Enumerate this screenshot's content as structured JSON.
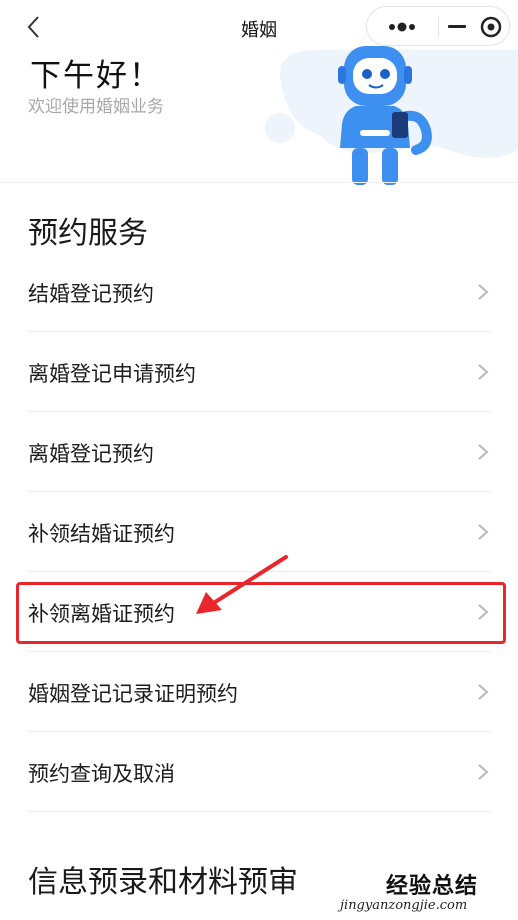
{
  "navbar": {
    "title": "婚姻"
  },
  "header": {
    "greeting": "下午好！",
    "welcome": "欢迎使用婚姻业务"
  },
  "booking": {
    "title": "预约服务",
    "items": [
      {
        "label": "结婚登记预约"
      },
      {
        "label": "离婚登记申请预约"
      },
      {
        "label": "离婚登记预约"
      },
      {
        "label": "补领结婚证预约"
      },
      {
        "label": "补领离婚证预约"
      },
      {
        "label": "婚姻登记记录证明预约"
      },
      {
        "label": "预约查询及取消"
      }
    ]
  },
  "prereview": {
    "title": "信息预录和材料预审"
  },
  "watermark": {
    "main": "经验总结",
    "sub": "jingyanzongjie.com"
  },
  "colors": {
    "highlight": "#e8262b",
    "mascot": "#3d8ff0",
    "banner_bg": "#eef4fc"
  }
}
